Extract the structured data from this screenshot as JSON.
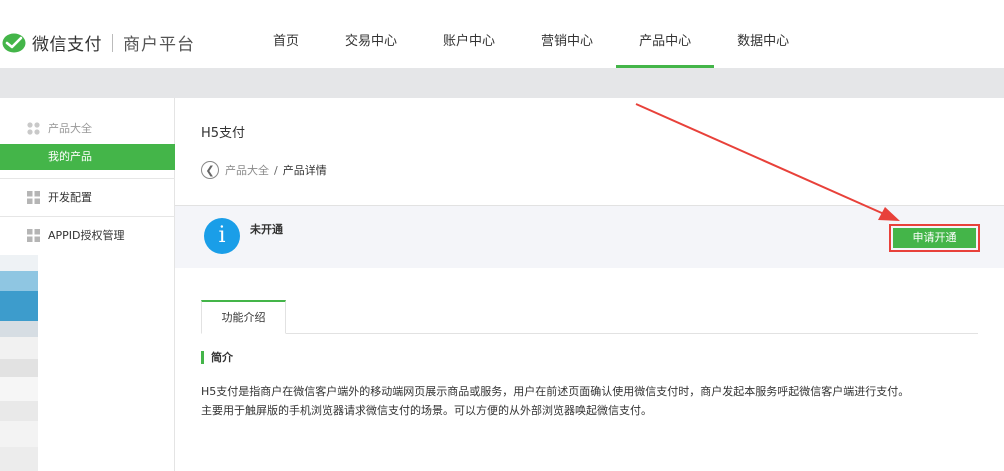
{
  "header": {
    "logo_text": "微信支付",
    "logo_sub": "商户平台",
    "nav": [
      {
        "label": "首页"
      },
      {
        "label": "交易中心"
      },
      {
        "label": "账户中心"
      },
      {
        "label": "营销中心"
      },
      {
        "label": "产品中心",
        "active": true
      },
      {
        "label": "数据中心"
      }
    ]
  },
  "sidebar": {
    "category": "产品大全",
    "active_item": "我的产品",
    "items": [
      {
        "label": "开发配置"
      },
      {
        "label": "APPID授权管理"
      }
    ]
  },
  "main": {
    "title": "H5支付",
    "breadcrumb": {
      "parent": "产品大全",
      "separator": "/",
      "current": "产品详情"
    },
    "status": "未开通",
    "apply_button": "申请开通",
    "tab": "功能介绍",
    "section_title": "简介",
    "description": [
      "H5支付是指商户在微信客户端外的移动端网页展示商品或服务，用户在前述页面确认使用微信支付时，商户发起本服务呼起微信客户端进行支付。",
      "主要用于触屏版的手机浏览器请求微信支付的场景。可以方便的从外部浏览器唤起微信支付。"
    ]
  },
  "colors": {
    "brand_green": "#44b549",
    "info_blue": "#1a9ee8",
    "annotation_red": "#e8413a"
  }
}
